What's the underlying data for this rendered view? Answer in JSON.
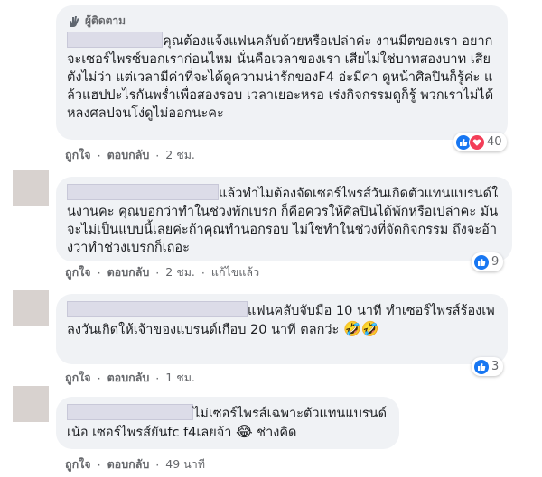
{
  "colors": {
    "bubble": "#f0f2f5",
    "meta": "#65676b",
    "like": "#1877f2",
    "heart": "#f33e58",
    "avatar": "#d8d2cf"
  },
  "comments": [
    {
      "badge": "ผู้ติดตาม",
      "text": "คุณต้องแจ้งแฟนคลับด้วยหรือเปล่าค่ะ งานมีตของเรา อยากจะเซอร์ไพรซ์บอกเราก่อนไหม นั่นคือเวลาของเรา เสียไม่ใช่บาทสองบาท เสียตังไม่ว่า แต่เวลามีค่าที่จะได้ดูความน่ารักของF4 อ่ะมีค่า ดูหน้าศิลปินก็รู้ค่ะ แล้วแฮปปะไรกันพร่ำเพื่อสองรอบ เวลาเยอะหรอ เร่งกิจกรรมดูก็รู้ พวกเราไม่ได้หลงศลปจนโง่ดูไม่ออกนะคะ",
      "like_label": "ถูกใจ",
      "reply_label": "ตอบกลับ",
      "time": "2 ชม.",
      "reaction_icons": [
        "like-icon",
        "heart-icon"
      ],
      "reaction_count": "40"
    },
    {
      "text": "แล้วทำไมต้องจัดเซอร์ไพรส์วันเกิดตัวแทนแบรนด์ในงานคะ คุณบอกว่าทำในช่วงพักเบรก ก็คือควรให้ศิลปินได้พักหรือเปล่าคะ มันจะไม่เป็นแบบนี้เลยค่ะถ้าคุณทำนอกรอบ ไม่ใช่ทำในช่วงที่จัดกิจกรรม ถึงจะอ้างว่าทำช่วงเบรกก็เถอะ",
      "like_label": "ถูกใจ",
      "reply_label": "ตอบกลับ",
      "time": "2 ชม.",
      "edited": "แก้ไขแล้ว",
      "reaction_icons": [
        "like-icon"
      ],
      "reaction_count": "9"
    },
    {
      "text": "แฟนคลับจับมือ 10 นาที ทำเซอร์ไพรส์ร้องเพลงวันเกิดให้เจ้าของแบรนด์เกือบ 20 นาที ตลกว่ะ",
      "emojis": "🤣🤣",
      "like_label": "ถูกใจ",
      "reply_label": "ตอบกลับ",
      "time": "1 ชม.",
      "reaction_icons": [
        "like-icon"
      ],
      "reaction_count": "3"
    },
    {
      "text": "ไม่เซอร์ไพรส์เฉพาะตัวแทนแบรนด์เน้อ เซอร์ไพรส์ยันfc f4เลยจ้า",
      "emoji_inline": "😂",
      "text_tail": "ช่างคิด",
      "like_label": "ถูกใจ",
      "reply_label": "ตอบกลับ",
      "time": "49 นาที"
    }
  ]
}
